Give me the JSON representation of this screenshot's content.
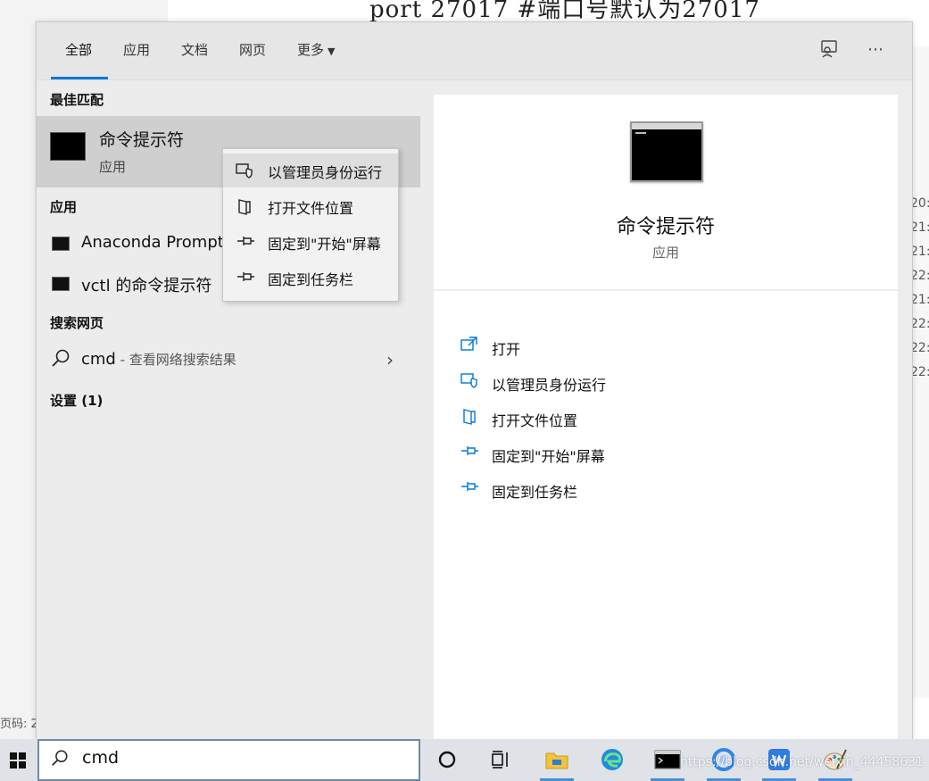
{
  "background": {
    "code_line": "port 27017 #端口号默认为27017",
    "times": [
      "20:",
      "21:",
      "21:",
      "22:",
      "21:",
      "22:",
      "22:",
      "22:"
    ],
    "footer_text": "页码: 2"
  },
  "tabs": [
    {
      "label": "全部",
      "active": true
    },
    {
      "label": "应用",
      "active": false
    },
    {
      "label": "文档",
      "active": false
    },
    {
      "label": "网页",
      "active": false
    },
    {
      "label": "更多",
      "active": false
    }
  ],
  "sections": {
    "best_match": "最佳匹配",
    "apps": "应用",
    "web": "搜索网页",
    "settings": "设置 (1)"
  },
  "best_match": {
    "title": "命令提示符",
    "subtitle": "应用"
  },
  "apps": [
    {
      "label": "Anaconda Prompt"
    },
    {
      "label": "vctl 的命令提示符"
    }
  ],
  "web_result": {
    "query": "cmd",
    "hint": " - 查看网络搜索结果"
  },
  "context_menu": [
    {
      "label": "以管理员身份运行",
      "icon": "admin-shield-icon"
    },
    {
      "label": "打开文件位置",
      "icon": "folder-location-icon"
    },
    {
      "label": "固定到\"开始\"屏幕",
      "icon": "pin-icon"
    },
    {
      "label": "固定到任务栏",
      "icon": "pin-icon"
    }
  ],
  "preview": {
    "title": "命令提示符",
    "subtitle": "应用",
    "actions": [
      {
        "label": "打开",
        "icon": "open-icon"
      },
      {
        "label": "以管理员身份运行",
        "icon": "admin-shield-icon"
      },
      {
        "label": "打开文件位置",
        "icon": "folder-location-icon"
      },
      {
        "label": "固定到\"开始\"屏幕",
        "icon": "pin-icon"
      },
      {
        "label": "固定到任务栏",
        "icon": "pin-icon"
      }
    ]
  },
  "taskbar": {
    "search_value": "cmd",
    "watermark": "https://blog.csdn.net/weixin_44458631"
  },
  "colors": {
    "accent": "#0078d7",
    "taskbar": "#dfe3e8",
    "panel": "#ececec"
  }
}
